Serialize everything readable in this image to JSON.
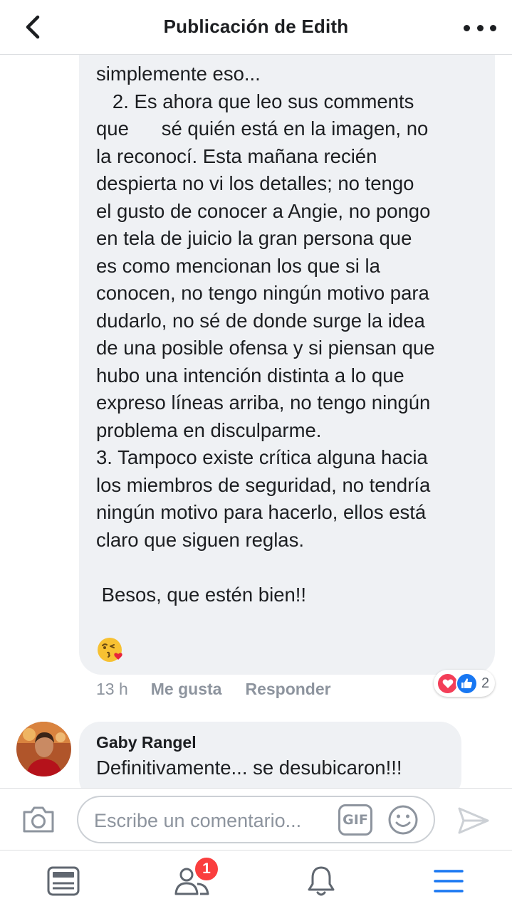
{
  "header": {
    "title": "Publicación de Edith"
  },
  "comment": {
    "text": "simplemente eso...\n   2. Es ahora que leo sus comments\nque      sé quién está en la imagen, no\nla reconocí. Esta mañana recién\ndespierta no vi los detalles; no tengo\nel gusto de conocer a Angie, no pongo\nen tela de juicio la gran persona que\nes como mencionan los que si la\nconocen, no tengo ningún motivo para\ndudarlo, no sé de donde surge la idea\nde una posible ofensa y si piensan que\nhubo una intención distinta a lo que\nexpreso líneas arriba, no tengo ningún\nproblema en disculparme.\n3. Tampoco existe crítica alguna hacia\nlos miembros de seguridad, no tendría\nningún motivo para hacerlo, ellos está\nclaro que siguen reglas.\n\n Besos, que estén bien!!",
    "emoji": "face-blowing-kiss",
    "time": "13 h",
    "like_label": "Me gusta",
    "reply_label": "Responder",
    "reactions": [
      "love",
      "like"
    ],
    "reaction_count": "2"
  },
  "reply": {
    "author": "Gaby Rangel",
    "text": "Definitivamente... se desubicaron!!!"
  },
  "composer": {
    "placeholder": "Escribe un comentario...",
    "gif_label": "GIF"
  },
  "nav": {
    "friends_badge": "1",
    "active": "menu"
  },
  "colors": {
    "accent": "#1877f2",
    "love": "#f33e58",
    "badge": "#fa3e3e",
    "bubble": "#eff1f4",
    "muted": "#8d949e"
  }
}
